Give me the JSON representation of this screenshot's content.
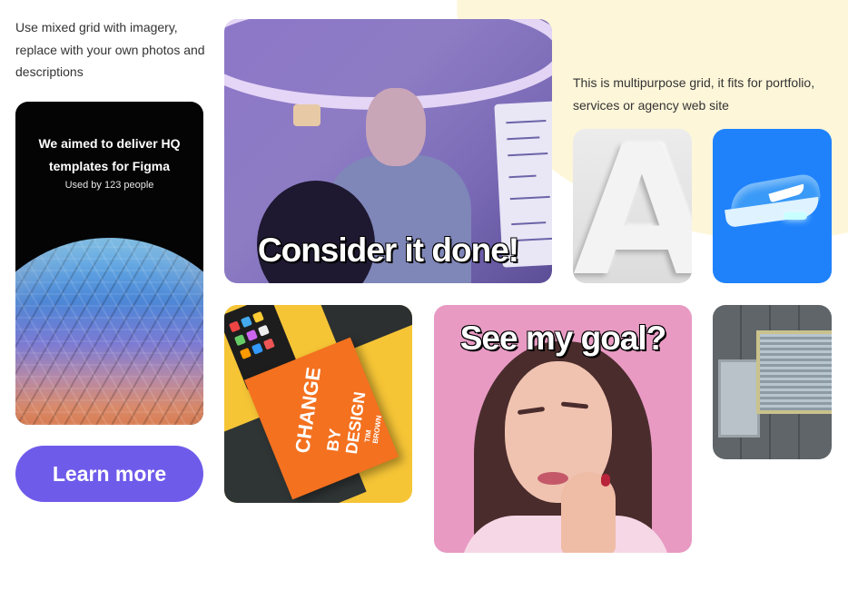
{
  "intro_left": "Use mixed grid with imagery, replace with your own photos and descriptions",
  "intro_right": "This is multipurpose grid, it fits for portfolio, services or agency web site",
  "promo_card": {
    "title": "We aimed to deliver HQ templates for Figma",
    "subtitle": "Used by 123 people"
  },
  "cta": {
    "label": "Learn more"
  },
  "presenter_card": {
    "overlay": "Consider it done!"
  },
  "goal_card": {
    "overlay": "See my goal?"
  },
  "letter_card": {
    "letter": "A"
  },
  "book_card": {
    "title_line1": "CHANGE",
    "title_line2": "BY DESIGN",
    "author": "TIM BROWN"
  },
  "colors": {
    "accent": "#6f5bea",
    "cream": "#fdf6d9",
    "shoe_bg": "#1f82fb",
    "goal_bg": "#e89ac3"
  }
}
